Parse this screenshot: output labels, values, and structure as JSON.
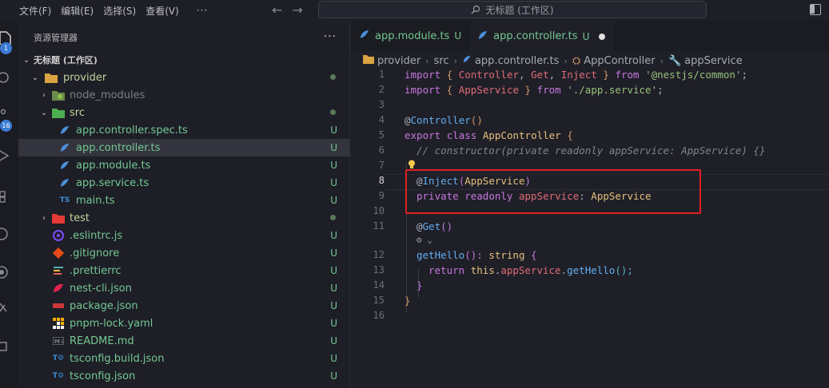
{
  "menu": [
    "文件(F)",
    "编辑(E)",
    "选择(S)",
    "查看(V)",
    "···"
  ],
  "command_center": {
    "text": "无标题 (工作区)"
  },
  "activity_badges": {
    "explorer": "1",
    "scm": "16"
  },
  "sidebar": {
    "title": "资源管理器",
    "more": "···",
    "workspace": "无标题 (工作区)",
    "items": [
      {
        "label": "provider",
        "status": "",
        "kind": "folder-open"
      },
      {
        "label": "node_modules",
        "status": "",
        "kind": "folder"
      },
      {
        "label": "src",
        "status": "",
        "kind": "folder-open"
      },
      {
        "label": "app.controller.spec.ts",
        "status": "U",
        "kind": "nest"
      },
      {
        "label": "app.controller.ts",
        "status": "U",
        "kind": "nest"
      },
      {
        "label": "app.module.ts",
        "status": "U",
        "kind": "nest"
      },
      {
        "label": "app.service.ts",
        "status": "U",
        "kind": "nest"
      },
      {
        "label": "main.ts",
        "status": "U",
        "kind": "ts"
      },
      {
        "label": "test",
        "status": "",
        "kind": "folder"
      },
      {
        "label": ".eslintrc.js",
        "status": "U",
        "kind": "eslint"
      },
      {
        "label": ".gitignore",
        "status": "U",
        "kind": "git"
      },
      {
        "label": ".prettierrc",
        "status": "U",
        "kind": "prettier"
      },
      {
        "label": "nest-cli.json",
        "status": "U",
        "kind": "nestcli"
      },
      {
        "label": "package.json",
        "status": "U",
        "kind": "npm"
      },
      {
        "label": "pnpm-lock.yaml",
        "status": "U",
        "kind": "pnpm"
      },
      {
        "label": "README.md",
        "status": "U",
        "kind": "md"
      },
      {
        "label": "tsconfig.build.json",
        "status": "U",
        "kind": "tsconfig"
      },
      {
        "label": "tsconfig.json",
        "status": "U",
        "kind": "tsconfig"
      }
    ]
  },
  "tabs": [
    {
      "label": "app.module.ts",
      "status": "U"
    },
    {
      "label": "app.controller.ts",
      "status": "U"
    }
  ],
  "breadcrumb": [
    "provider",
    "src",
    "app.controller.ts",
    "AppController",
    "appService"
  ],
  "line_numbers": [
    "1",
    "2",
    "3",
    "4",
    "5",
    "6",
    "7",
    "8",
    "9",
    "10",
    "11",
    "12",
    "13",
    "14",
    "15",
    "16"
  ],
  "code": {
    "l1": {
      "a": "import",
      "b": " { ",
      "c": "Controller",
      "d": ", ",
      "e": "Get",
      "f": ", ",
      "g": "Inject",
      "h": " } ",
      "i": "from",
      "j": " ",
      "k": "'@nestjs/common'",
      "l": ";"
    },
    "l2": {
      "a": "import",
      "b": " { ",
      "c": "AppService",
      "d": " } ",
      "e": "from",
      "f": " ",
      "g": "'./app.service'",
      "h": ";"
    },
    "l4": {
      "a": "@",
      "b": "Controller",
      "c": "()"
    },
    "l5": {
      "a": "export",
      "b": " ",
      "c": "class",
      "d": " ",
      "e": "AppController",
      "f": " {"
    },
    "l6": {
      "a": "// constructor(private readonly appService: AppService) {}"
    },
    "l8": {
      "a": "@",
      "b": "Inject",
      "c": "(",
      "d": "AppService",
      "e": ")"
    },
    "l9": {
      "a": "private",
      "b": " ",
      "c": "readonly",
      "d": " ",
      "e": "appService",
      "f": ": ",
      "g": "AppService"
    },
    "l11": {
      "a": "@",
      "b": "Get",
      "c": "()"
    },
    "l12": {
      "a": "getHello",
      "b": "(): ",
      "c": "string",
      "d": " {"
    },
    "l13": {
      "a": "return",
      "b": " ",
      "c": "this",
      "d": ".",
      "e": "appService",
      "f": ".",
      "g": "getHello",
      "h": "();"
    },
    "l14": {
      "a": "}"
    },
    "l15": {
      "a": "}"
    }
  },
  "colors": {
    "accent": "#3b7bd6",
    "untracked": "#73c991",
    "highlight_box": "#e02020"
  }
}
